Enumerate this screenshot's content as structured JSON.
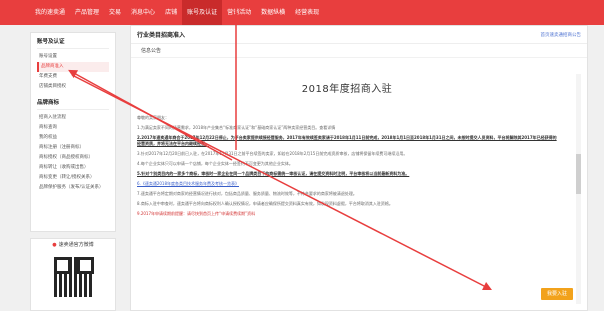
{
  "nav": {
    "items": [
      "我的速卖通",
      "产品管理",
      "交易",
      "消息中心",
      "店铺",
      "账号及认证",
      "营销活动",
      "数据纵横",
      "经营表现"
    ],
    "active_index": 5
  },
  "sidebar": {
    "group1": {
      "title": "账号及认证",
      "items": [
        "账号设置",
        "品牌商准入",
        "年费支费",
        "店铺类目授权"
      ]
    },
    "group2": {
      "title": "品牌商标",
      "items": [
        "招商入驻流程",
        "商标查询",
        "我的权益",
        "商标注册（注册商标）",
        "商标授权（商品授权商标）",
        "商标转让（收购或出售）",
        "商标变更（转让/授权关系）",
        "品牌保护服务（发布/认证关系）"
      ]
    },
    "active_item": "品牌商准入"
  },
  "qr": {
    "label": "速卖通官方微博"
  },
  "main": {
    "title": "行业类目招商准入",
    "top_link": "首页速卖通招商公告",
    "sub_tab": "信息公告",
    "notice_title": "2018年度招商入驻",
    "paragraphs": [
      {
        "text": "尊敬的卖家朋友：",
        "style": "normal"
      },
      {
        "text": "1.为满足卖家不同的经营需求，2018年产业集合“标准商家认证”和“基础商家认证”两种卖家经营类目。查看详情",
        "style": "normal"
      },
      {
        "text": "2.2017年速卖通年商会于2017年12月22日停止，为平台卖家提供续接经营服务，2017年有效续签卖家请于2018年1月11日前完成，2018年1月1日至2018年1月31日之间，未按时提交人员资料，平台将解除其2017年已经获得的经营资质，并将无法在平台内继续经营。",
        "style": "bold"
      },
      {
        "text": "3.针对2017年12月20日前已入驻，在2017年12月31日之前平台续签的卖家，如若在2018年2月15日前完成资质审核，店铺将保留年续费可继续沿用。",
        "style": "normal"
      },
      {
        "text": "4.每个企业实体只可以申请一个店铺，每个企业实体一经签约不可变更为其他企业实体。",
        "style": "normal"
      },
      {
        "text": "5.针对个别类目内的一家多个商标，审核时一家企业在同一个品牌类目下的商标需统一审核认证，请在提交资料时注明，平台审核将以当前最新资料为准。",
        "style": "bold"
      },
      {
        "text": "6.《速卖通2018年度各类目技术服务年费及考核一览表》",
        "style": "blue"
      },
      {
        "text": "7.速卖通平台将定期对商家的经营情况进行核对，包括商品质量、服务质量、物流时效等，不符合要求的商家将被清退处理。",
        "style": "normal"
      },
      {
        "text": "8.商标入驻中审查时，速卖通平台将向商标权利人确认授权情况，申请者应确保所提交资料真实有效，如发现资料虚假，平台将取消其入驻资格。",
        "style": "normal"
      },
      {
        "text": "9.2017年申请续期前提醒：请尽快到首页上传“申请续费续期”资料",
        "style": "red"
      }
    ],
    "enter_button": "我要入驻"
  },
  "colors": {
    "brand_red": "#e83e3e",
    "active_nav": "#c92b2b",
    "button_orange": "#f2a21b",
    "link_blue": "#3a5fc9"
  }
}
